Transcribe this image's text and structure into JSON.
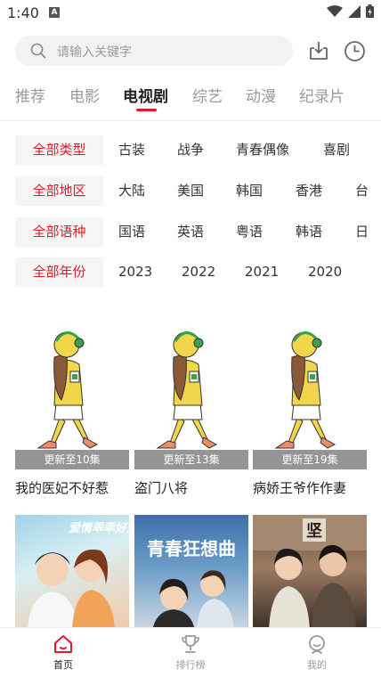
{
  "status_bar": {
    "time": "1:40"
  },
  "search": {
    "placeholder": "请输入关键字"
  },
  "tabs": [
    {
      "label": "推荐"
    },
    {
      "label": "电影"
    },
    {
      "label": "电视剧"
    },
    {
      "label": "综艺"
    },
    {
      "label": "动漫"
    },
    {
      "label": "纪录片"
    }
  ],
  "active_tab": "电视剧",
  "filters": {
    "type": {
      "all": "全部类型",
      "options": [
        "古装",
        "战争",
        "青春偶像",
        "喜剧"
      ]
    },
    "region": {
      "all": "全部地区",
      "options": [
        "大陆",
        "美国",
        "韩国",
        "香港",
        "台"
      ]
    },
    "language": {
      "all": "全部语种",
      "options": [
        "国语",
        "英语",
        "粤语",
        "韩语",
        "日"
      ]
    },
    "year": {
      "all": "全部年份",
      "options": [
        "2023",
        "2022",
        "2021",
        "2020"
      ]
    }
  },
  "cards": [
    {
      "badge": "更新至10集",
      "title": "我的医妃不好惹"
    },
    {
      "badge": "更新至13集",
      "title": "盗门八将"
    },
    {
      "badge": "更新至19集",
      "title": "病娇王爷作作妻"
    }
  ],
  "posters": [
    {
      "text": "爱情乖乖好爱"
    },
    {
      "text": "青春狂想曲"
    },
    {
      "text": "坚"
    }
  ],
  "bottom_nav": [
    {
      "label": "首页",
      "icon": "home-icon"
    },
    {
      "label": "排行榜",
      "icon": "trophy-icon"
    },
    {
      "label": "我的",
      "icon": "profile-icon"
    }
  ],
  "colors": {
    "accent": "#e3192a",
    "muted": "#9a9a9a",
    "filter_bg": "#f5f5f5"
  }
}
